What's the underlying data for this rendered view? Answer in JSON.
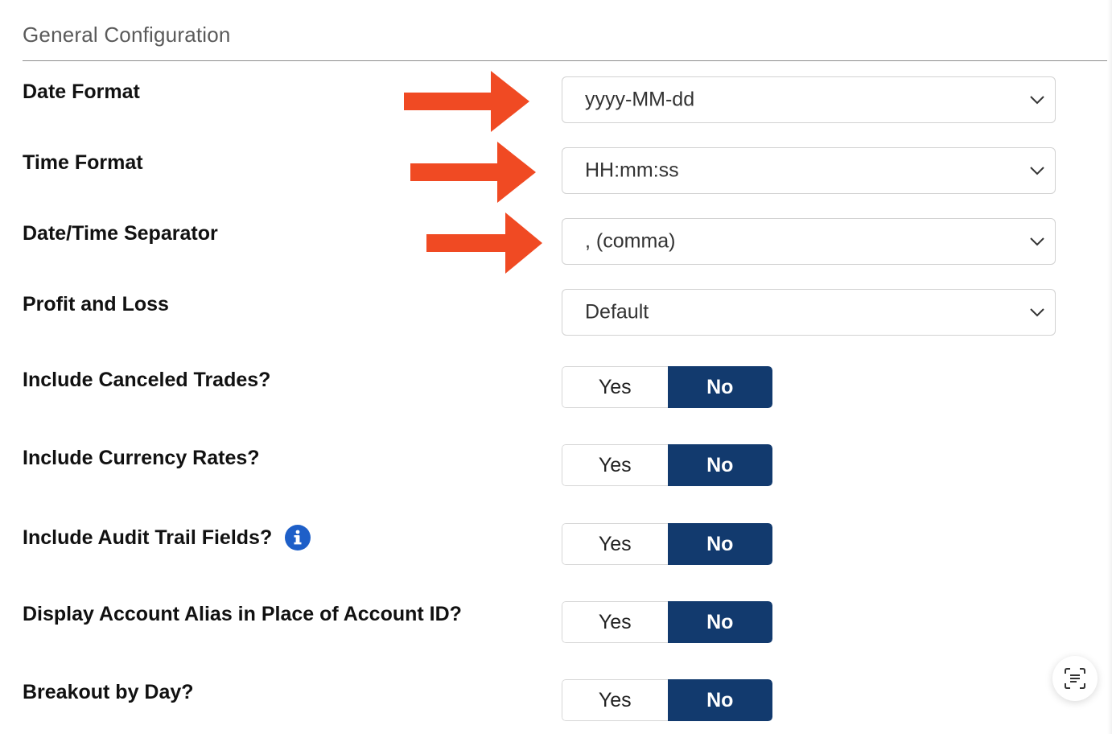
{
  "section": {
    "title": "General Configuration"
  },
  "colors": {
    "toggle_selected": "#123a6e",
    "annotation_arrow": "#f04a23",
    "info_icon": "#1e5fc8"
  },
  "selects": [
    {
      "label": "Date Format",
      "value": "yyyy-MM-dd",
      "icon": "chevron-down-icon"
    },
    {
      "label": "Time Format",
      "value": "HH:mm:ss",
      "icon": "chevron-down-icon"
    },
    {
      "label": "Date/Time Separator",
      "value": ", (comma)",
      "icon": "chevron-down-icon"
    },
    {
      "label": "Profit and Loss",
      "value": "Default",
      "icon": "chevron-down-icon"
    }
  ],
  "toggles": [
    {
      "label": "Include Canceled Trades?",
      "yes": "Yes",
      "no": "No",
      "selected": "No"
    },
    {
      "label": "Include Currency Rates?",
      "yes": "Yes",
      "no": "No",
      "selected": "No"
    },
    {
      "label": "Include Audit Trail Fields?",
      "yes": "Yes",
      "no": "No",
      "selected": "No",
      "icon": "info-icon"
    },
    {
      "label": "Display Account Alias in Place of Account ID?",
      "yes": "Yes",
      "no": "No",
      "selected": "No"
    },
    {
      "label": "Breakout by Day?",
      "yes": "Yes",
      "no": "No",
      "selected": "No"
    }
  ],
  "annotations": {
    "arrows": [
      "arrow-right-icon",
      "arrow-right-icon",
      "arrow-right-icon"
    ]
  },
  "floating": {
    "icon": "text-scan-icon"
  }
}
